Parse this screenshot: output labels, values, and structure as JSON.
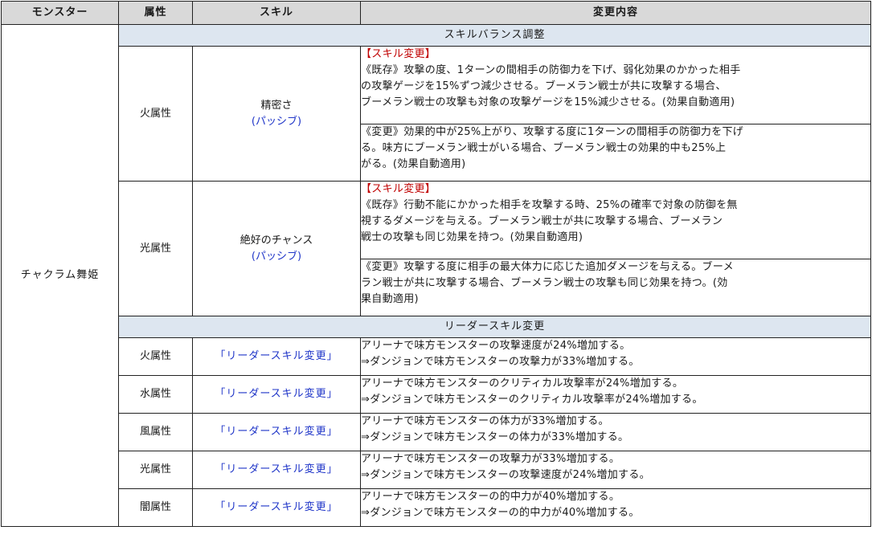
{
  "header": {
    "monster": "モンスター",
    "attribute": "属性",
    "skill": "スキル",
    "change": "変更内容"
  },
  "monster_name": "チャクラム舞姫",
  "sections": {
    "balance": "スキルバランス調整",
    "leader": "リーダースキル変更"
  },
  "balance_rows": [
    {
      "attribute": "火属性",
      "skill_name": "精密さ",
      "skill_type": "(パッシブ)",
      "tag": "【スキル変更】",
      "before": [
        "《既存》攻撃の度、1ターンの間相手の防御力を下げ、弱化効果のかかった相手",
        "の攻撃ゲージを15%ずつ減少させる。ブーメラン戦士が共に攻撃する場合、",
        "ブーメラン戦士の攻撃も対象の攻撃ゲージを15%減少させる。(効果自動適用)"
      ],
      "after": [
        "《変更》効果的中が25%上がり、攻撃する度に1ターンの間相手の防御力を下げ",
        "る。味方にブーメラン戦士がいる場合、ブーメラン戦士の効果的中も25%上",
        "がる。(効果自動適用)"
      ]
    },
    {
      "attribute": "光属性",
      "skill_name": "絶好のチャンス",
      "skill_type": "(パッシブ)",
      "tag": "【スキル変更】",
      "before": [
        "《既存》行動不能にかかった相手を攻撃する時、25%の確率で対象の防御を無",
        "視するダメージを与える。ブーメラン戦士が共に攻撃する場合、ブーメラン",
        "戦士の攻撃も同じ効果を持つ。(効果自動適用)"
      ],
      "after": [
        "《変更》攻撃する度に相手の最大体力に応じた追加ダメージを与える。ブーメ",
        "ラン戦士が共に攻撃する場合、ブーメラン戦士の攻撃も同じ効果を持つ。(効",
        "果自動適用)"
      ]
    }
  ],
  "leader_rows": [
    {
      "attribute": "火属性",
      "skill": "「リーダースキル変更」",
      "lines": [
        "アリーナで味方モンスターの攻撃速度が24%増加する。",
        "⇒ダンジョンで味方モンスターの攻撃力が33%増加する。"
      ]
    },
    {
      "attribute": "水属性",
      "skill": "「リーダースキル変更」",
      "lines": [
        "アリーナで味方モンスターのクリティカル攻撃率が24%増加する。",
        "⇒ダンジョンで味方モンスターのクリティカル攻撃率が24%増加する。"
      ]
    },
    {
      "attribute": "風属性",
      "skill": "「リーダースキル変更」",
      "lines": [
        "アリーナで味方モンスターの体力が33%増加する。",
        "⇒ダンジョンで味方モンスターの体力が33%増加する。"
      ]
    },
    {
      "attribute": "光属性",
      "skill": "「リーダースキル変更」",
      "lines": [
        "アリーナで味方モンスターの攻撃力が33%増加する。",
        "⇒ダンジョンで味方モンスターの攻撃速度が24%増加する。"
      ]
    },
    {
      "attribute": "闇属性",
      "skill": "「リーダースキル変更」",
      "lines": [
        "アリーナで味方モンスターの的中力が40%増加する。",
        "⇒ダンジョンで味方モンスターの的中力が40%増加する。"
      ]
    }
  ],
  "colors": {
    "header_bg": "#d9d9d9",
    "section_bg": "#dde6f0",
    "skill_blue": "#1f35c8",
    "tag_red": "#c00000"
  }
}
